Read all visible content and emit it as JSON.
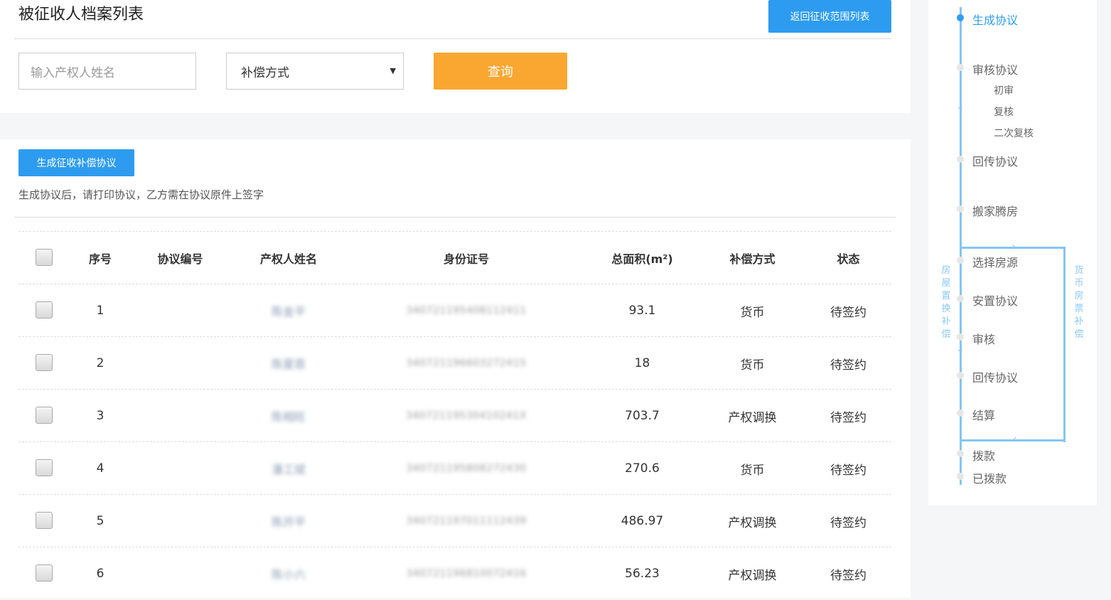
{
  "page": {
    "title": "被征收人档案列表",
    "back_button": "返回征收范围列表"
  },
  "filters": {
    "name_placeholder": "输入产权人姓名",
    "compensation_select": "补偿方式",
    "query_button": "查询"
  },
  "actions": {
    "generate_button": "生成征收补偿协议",
    "hint": "生成协议后，请打印协议，乙方需在协议原件上签字"
  },
  "table": {
    "columns": [
      "序号",
      "协议编号",
      "产权人姓名",
      "身份证号",
      "总面积(m²)",
      "补偿方式",
      "状态"
    ],
    "rows": [
      {
        "no": "1",
        "agreement": "",
        "owner": "陈金平",
        "id": "340721195408112411",
        "area": "93.1",
        "method": "货币",
        "status": "待签约"
      },
      {
        "no": "2",
        "agreement": "",
        "owner": "陈夏恩",
        "id": "340721196603272415",
        "area": "18",
        "method": "货币",
        "status": "待签约"
      },
      {
        "no": "3",
        "agreement": "",
        "owner": "陈相旺",
        "id": "34072119530410241X",
        "area": "703.7",
        "method": "产权调换",
        "status": "待签约"
      },
      {
        "no": "4",
        "agreement": "",
        "owner": "潘工斌",
        "id": "340721195808272430",
        "area": "270.6",
        "method": "货币",
        "status": "待签约"
      },
      {
        "no": "5",
        "agreement": "",
        "owner": "陈开平",
        "id": "340721197011112439",
        "area": "486.97",
        "method": "产权调换",
        "status": "待签约"
      },
      {
        "no": "6",
        "agreement": "",
        "owner": "陈小六",
        "id": "340721196810072416",
        "area": "56.23",
        "method": "产权调换",
        "status": "待签约"
      }
    ]
  },
  "workflow": {
    "steps": {
      "generate": "生成协议",
      "review": "审核协议",
      "first_review": "初审",
      "re_review": "复核",
      "second_re_review": "二次复核",
      "return": "回传协议",
      "move": "搬家腾房",
      "choose_house": "选择房源",
      "resettle": "安置协议",
      "audit": "审核",
      "return2": "回传协议",
      "settle": "结算",
      "pay": "拨款",
      "paid": "已拨款"
    },
    "left_branch": "房屋置换补偿",
    "right_branch": "货币房票补偿",
    "active_color": "#2d9cf0",
    "line_color": "#86c5f2"
  }
}
